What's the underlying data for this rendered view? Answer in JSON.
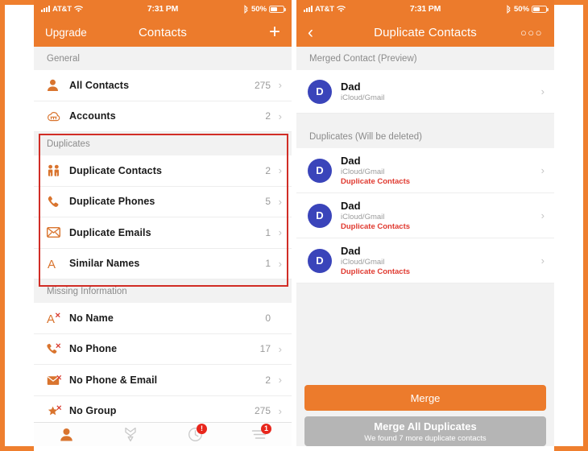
{
  "theme": {
    "accent": "#ec7b2c",
    "highlight_box": "#d12d26",
    "badge": "#e8261c",
    "avatar": "#3a44ba",
    "tag": "#e0392f"
  },
  "left_phone": {
    "status": {
      "carrier": "AT&T",
      "time": "7:31 PM",
      "battery_pct": "50%"
    },
    "nav": {
      "left_label": "Upgrade",
      "title": "Contacts",
      "right_icon": "plus-icon"
    },
    "sections": [
      {
        "header": "General",
        "rows": [
          {
            "icon": "person-icon",
            "label": "All Contacts",
            "value": "275",
            "chevron": true
          },
          {
            "icon": "accounts-cloud-icon",
            "label": "Accounts",
            "value": "2",
            "chevron": true
          }
        ]
      },
      {
        "header": "Duplicates",
        "highlighted": true,
        "rows": [
          {
            "icon": "two-people-icon",
            "label": "Duplicate Contacts",
            "value": "2",
            "chevron": true
          },
          {
            "icon": "phone-icon",
            "label": "Duplicate Phones",
            "value": "5",
            "chevron": true
          },
          {
            "icon": "envelope-icon",
            "label": "Duplicate Emails",
            "value": "1",
            "chevron": true
          },
          {
            "icon": "letter-a-icon",
            "label": "Similar Names",
            "value": "1",
            "chevron": true
          }
        ]
      },
      {
        "header": "Missing Information",
        "rows": [
          {
            "icon": "letter-a-x-icon",
            "label": "No Name",
            "value": "0",
            "chevron": false
          },
          {
            "icon": "phone-x-icon",
            "label": "No Phone",
            "value": "17",
            "chevron": true
          },
          {
            "icon": "envelope-x-icon",
            "label": "No Phone & Email",
            "value": "2",
            "chevron": true
          },
          {
            "icon": "star-x-icon",
            "label": "No Group",
            "value": "275",
            "chevron": true
          }
        ]
      }
    ],
    "tabs": [
      {
        "icon": "contacts-tab-icon",
        "active": true,
        "badge": ""
      },
      {
        "icon": "merge-tab-icon",
        "active": false,
        "badge": ""
      },
      {
        "icon": "history-tab-icon",
        "active": false,
        "badge": "!"
      },
      {
        "icon": "list-tab-icon",
        "active": false,
        "badge": "1"
      }
    ]
  },
  "right_phone": {
    "status": {
      "carrier": "AT&T",
      "time": "7:31 PM",
      "battery_pct": "50%"
    },
    "nav": {
      "left_icon": "back-chevron-icon",
      "title": "Duplicate Contacts",
      "right_icon": "more-dots-icon"
    },
    "preview_header": "Merged Contact (Preview)",
    "preview": {
      "initial": "D",
      "name": "Dad",
      "source": "iCloud/Gmail"
    },
    "duplicates_header": "Duplicates (Will be deleted)",
    "duplicates": [
      {
        "initial": "D",
        "name": "Dad",
        "source": "iCloud/Gmail",
        "tag": "Duplicate Contacts"
      },
      {
        "initial": "D",
        "name": "Dad",
        "source": "iCloud/Gmail",
        "tag": "Duplicate Contacts"
      },
      {
        "initial": "D",
        "name": "Dad",
        "source": "iCloud/Gmail",
        "tag": "Duplicate Contacts"
      }
    ],
    "merge_button": "Merge",
    "merge_all_button": {
      "title": "Merge All Duplicates",
      "subtitle": "We found 7 more duplicate contacts"
    }
  }
}
